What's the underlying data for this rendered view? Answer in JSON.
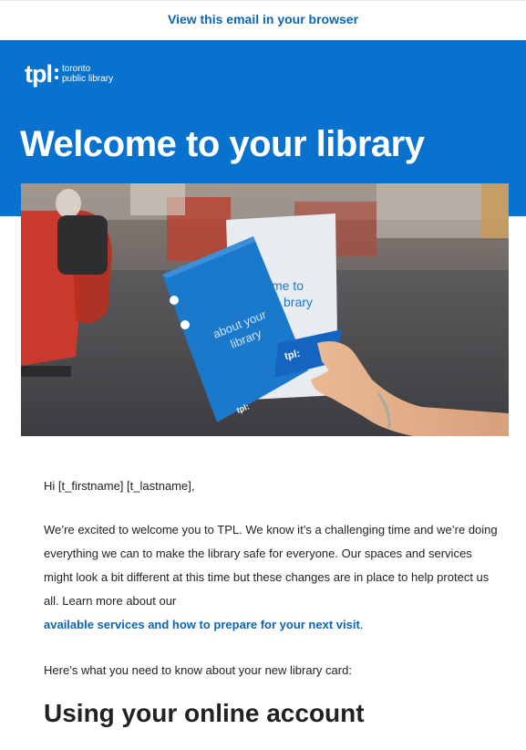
{
  "header": {
    "view_in_browser": "View this email in your browser"
  },
  "banner": {
    "logo_mark": "tpl",
    "logo_line1": "toronto",
    "logo_line2": "public library",
    "title": "Welcome to your library"
  },
  "hero": {
    "booklet_front_text_1": "about your",
    "booklet_front_text_2": "library",
    "booklet_back_text_1": "me to",
    "booklet_back_text_2": "brary",
    "card_logo": "tpl:",
    "booklet_front_logo": "tpl:"
  },
  "body": {
    "greeting": "Hi [t_firstname] [t_lastname],",
    "intro_text": "We’re excited to welcome you to TPL. We know it’s a challenging time and we’re doing everything we can to make the library safe for everyone. Our spaces and services might look a bit different at this time but these changes are in place to help protect us all. Learn more about our",
    "intro_link": "available services and how to prepare for your next visit",
    "intro_end": ".",
    "need_to_know": "Here’s what you need to know about your new library card:",
    "section_title": "Using your online account"
  },
  "colors": {
    "brand_blue": "#0971ce",
    "link_blue": "#0b65b6"
  }
}
